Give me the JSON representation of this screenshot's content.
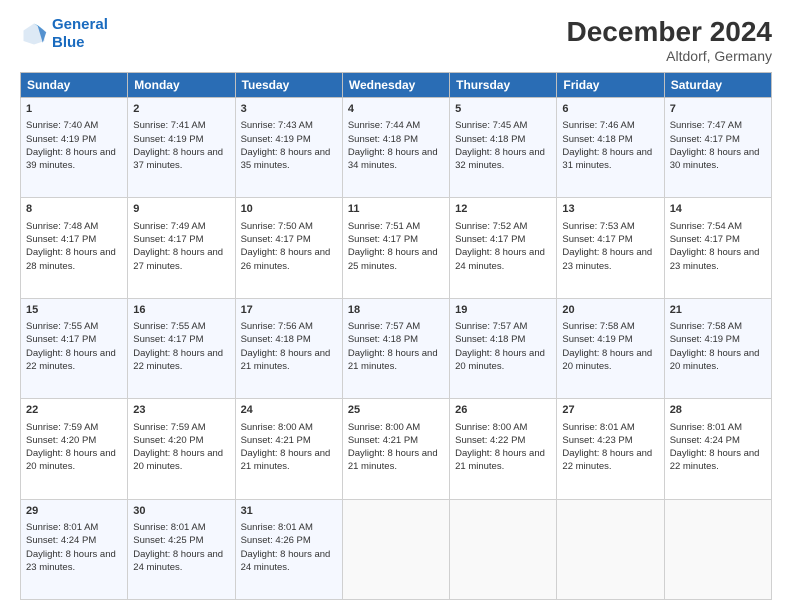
{
  "header": {
    "logo_line1": "General",
    "logo_line2": "Blue",
    "month": "December 2024",
    "location": "Altdorf, Germany"
  },
  "columns": [
    "Sunday",
    "Monday",
    "Tuesday",
    "Wednesday",
    "Thursday",
    "Friday",
    "Saturday"
  ],
  "weeks": [
    [
      {
        "day": "1",
        "info": "Sunrise: 7:40 AM\nSunset: 4:19 PM\nDaylight: 8 hours and 39 minutes."
      },
      {
        "day": "2",
        "info": "Sunrise: 7:41 AM\nSunset: 4:19 PM\nDaylight: 8 hours and 37 minutes."
      },
      {
        "day": "3",
        "info": "Sunrise: 7:43 AM\nSunset: 4:19 PM\nDaylight: 8 hours and 35 minutes."
      },
      {
        "day": "4",
        "info": "Sunrise: 7:44 AM\nSunset: 4:18 PM\nDaylight: 8 hours and 34 minutes."
      },
      {
        "day": "5",
        "info": "Sunrise: 7:45 AM\nSunset: 4:18 PM\nDaylight: 8 hours and 32 minutes."
      },
      {
        "day": "6",
        "info": "Sunrise: 7:46 AM\nSunset: 4:18 PM\nDaylight: 8 hours and 31 minutes."
      },
      {
        "day": "7",
        "info": "Sunrise: 7:47 AM\nSunset: 4:17 PM\nDaylight: 8 hours and 30 minutes."
      }
    ],
    [
      {
        "day": "8",
        "info": "Sunrise: 7:48 AM\nSunset: 4:17 PM\nDaylight: 8 hours and 28 minutes."
      },
      {
        "day": "9",
        "info": "Sunrise: 7:49 AM\nSunset: 4:17 PM\nDaylight: 8 hours and 27 minutes."
      },
      {
        "day": "10",
        "info": "Sunrise: 7:50 AM\nSunset: 4:17 PM\nDaylight: 8 hours and 26 minutes."
      },
      {
        "day": "11",
        "info": "Sunrise: 7:51 AM\nSunset: 4:17 PM\nDaylight: 8 hours and 25 minutes."
      },
      {
        "day": "12",
        "info": "Sunrise: 7:52 AM\nSunset: 4:17 PM\nDaylight: 8 hours and 24 minutes."
      },
      {
        "day": "13",
        "info": "Sunrise: 7:53 AM\nSunset: 4:17 PM\nDaylight: 8 hours and 23 minutes."
      },
      {
        "day": "14",
        "info": "Sunrise: 7:54 AM\nSunset: 4:17 PM\nDaylight: 8 hours and 23 minutes."
      }
    ],
    [
      {
        "day": "15",
        "info": "Sunrise: 7:55 AM\nSunset: 4:17 PM\nDaylight: 8 hours and 22 minutes."
      },
      {
        "day": "16",
        "info": "Sunrise: 7:55 AM\nSunset: 4:17 PM\nDaylight: 8 hours and 22 minutes."
      },
      {
        "day": "17",
        "info": "Sunrise: 7:56 AM\nSunset: 4:18 PM\nDaylight: 8 hours and 21 minutes."
      },
      {
        "day": "18",
        "info": "Sunrise: 7:57 AM\nSunset: 4:18 PM\nDaylight: 8 hours and 21 minutes."
      },
      {
        "day": "19",
        "info": "Sunrise: 7:57 AM\nSunset: 4:18 PM\nDaylight: 8 hours and 20 minutes."
      },
      {
        "day": "20",
        "info": "Sunrise: 7:58 AM\nSunset: 4:19 PM\nDaylight: 8 hours and 20 minutes."
      },
      {
        "day": "21",
        "info": "Sunrise: 7:58 AM\nSunset: 4:19 PM\nDaylight: 8 hours and 20 minutes."
      }
    ],
    [
      {
        "day": "22",
        "info": "Sunrise: 7:59 AM\nSunset: 4:20 PM\nDaylight: 8 hours and 20 minutes."
      },
      {
        "day": "23",
        "info": "Sunrise: 7:59 AM\nSunset: 4:20 PM\nDaylight: 8 hours and 20 minutes."
      },
      {
        "day": "24",
        "info": "Sunrise: 8:00 AM\nSunset: 4:21 PM\nDaylight: 8 hours and 21 minutes."
      },
      {
        "day": "25",
        "info": "Sunrise: 8:00 AM\nSunset: 4:21 PM\nDaylight: 8 hours and 21 minutes."
      },
      {
        "day": "26",
        "info": "Sunrise: 8:00 AM\nSunset: 4:22 PM\nDaylight: 8 hours and 21 minutes."
      },
      {
        "day": "27",
        "info": "Sunrise: 8:01 AM\nSunset: 4:23 PM\nDaylight: 8 hours and 22 minutes."
      },
      {
        "day": "28",
        "info": "Sunrise: 8:01 AM\nSunset: 4:24 PM\nDaylight: 8 hours and 22 minutes."
      }
    ],
    [
      {
        "day": "29",
        "info": "Sunrise: 8:01 AM\nSunset: 4:24 PM\nDaylight: 8 hours and 23 minutes."
      },
      {
        "day": "30",
        "info": "Sunrise: 8:01 AM\nSunset: 4:25 PM\nDaylight: 8 hours and 24 minutes."
      },
      {
        "day": "31",
        "info": "Sunrise: 8:01 AM\nSunset: 4:26 PM\nDaylight: 8 hours and 24 minutes."
      },
      {
        "day": "",
        "info": ""
      },
      {
        "day": "",
        "info": ""
      },
      {
        "day": "",
        "info": ""
      },
      {
        "day": "",
        "info": ""
      }
    ]
  ]
}
